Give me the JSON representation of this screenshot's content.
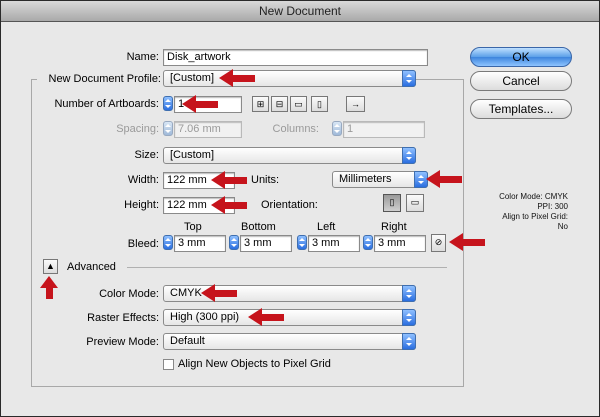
{
  "window": {
    "title": "New Document"
  },
  "buttons": {
    "ok": "OK",
    "cancel": "Cancel",
    "templates": "Templates..."
  },
  "name": {
    "label": "Name:",
    "value": "Disk_artwork"
  },
  "profile": {
    "label": "New Document Profile:",
    "value": "[Custom]"
  },
  "artboards": {
    "label": "Number of Artboards:",
    "value": "1",
    "spacing_label": "Spacing:",
    "spacing_value": "7.06 mm",
    "columns_label": "Columns:",
    "columns_value": "1"
  },
  "size": {
    "label": "Size:",
    "value": "[Custom]"
  },
  "width": {
    "label": "Width:",
    "value": "122 mm"
  },
  "height": {
    "label": "Height:",
    "value": "122 mm"
  },
  "units": {
    "label": "Units:",
    "value": "Millimeters"
  },
  "orientation": {
    "label": "Orientation:"
  },
  "bleed": {
    "label": "Bleed:",
    "top_label": "Top",
    "bottom_label": "Bottom",
    "left_label": "Left",
    "right_label": "Right",
    "top": "3 mm",
    "bottom": "3 mm",
    "left": "3 mm",
    "right": "3 mm"
  },
  "advanced": {
    "label": "Advanced",
    "color_mode_label": "Color Mode:",
    "color_mode": "CMYK",
    "raster_label": "Raster Effects:",
    "raster": "High (300 ppi)",
    "preview_label": "Preview Mode:",
    "preview": "Default",
    "align_label": "Align New Objects to Pixel Grid"
  },
  "summary": {
    "color_mode": "Color Mode: CMYK",
    "ppi": "PPI: 300",
    "align": "Align to Pixel Grid: No"
  },
  "colors": {
    "annotation_arrow": "#c6141c",
    "accent": "#3d85dd"
  }
}
